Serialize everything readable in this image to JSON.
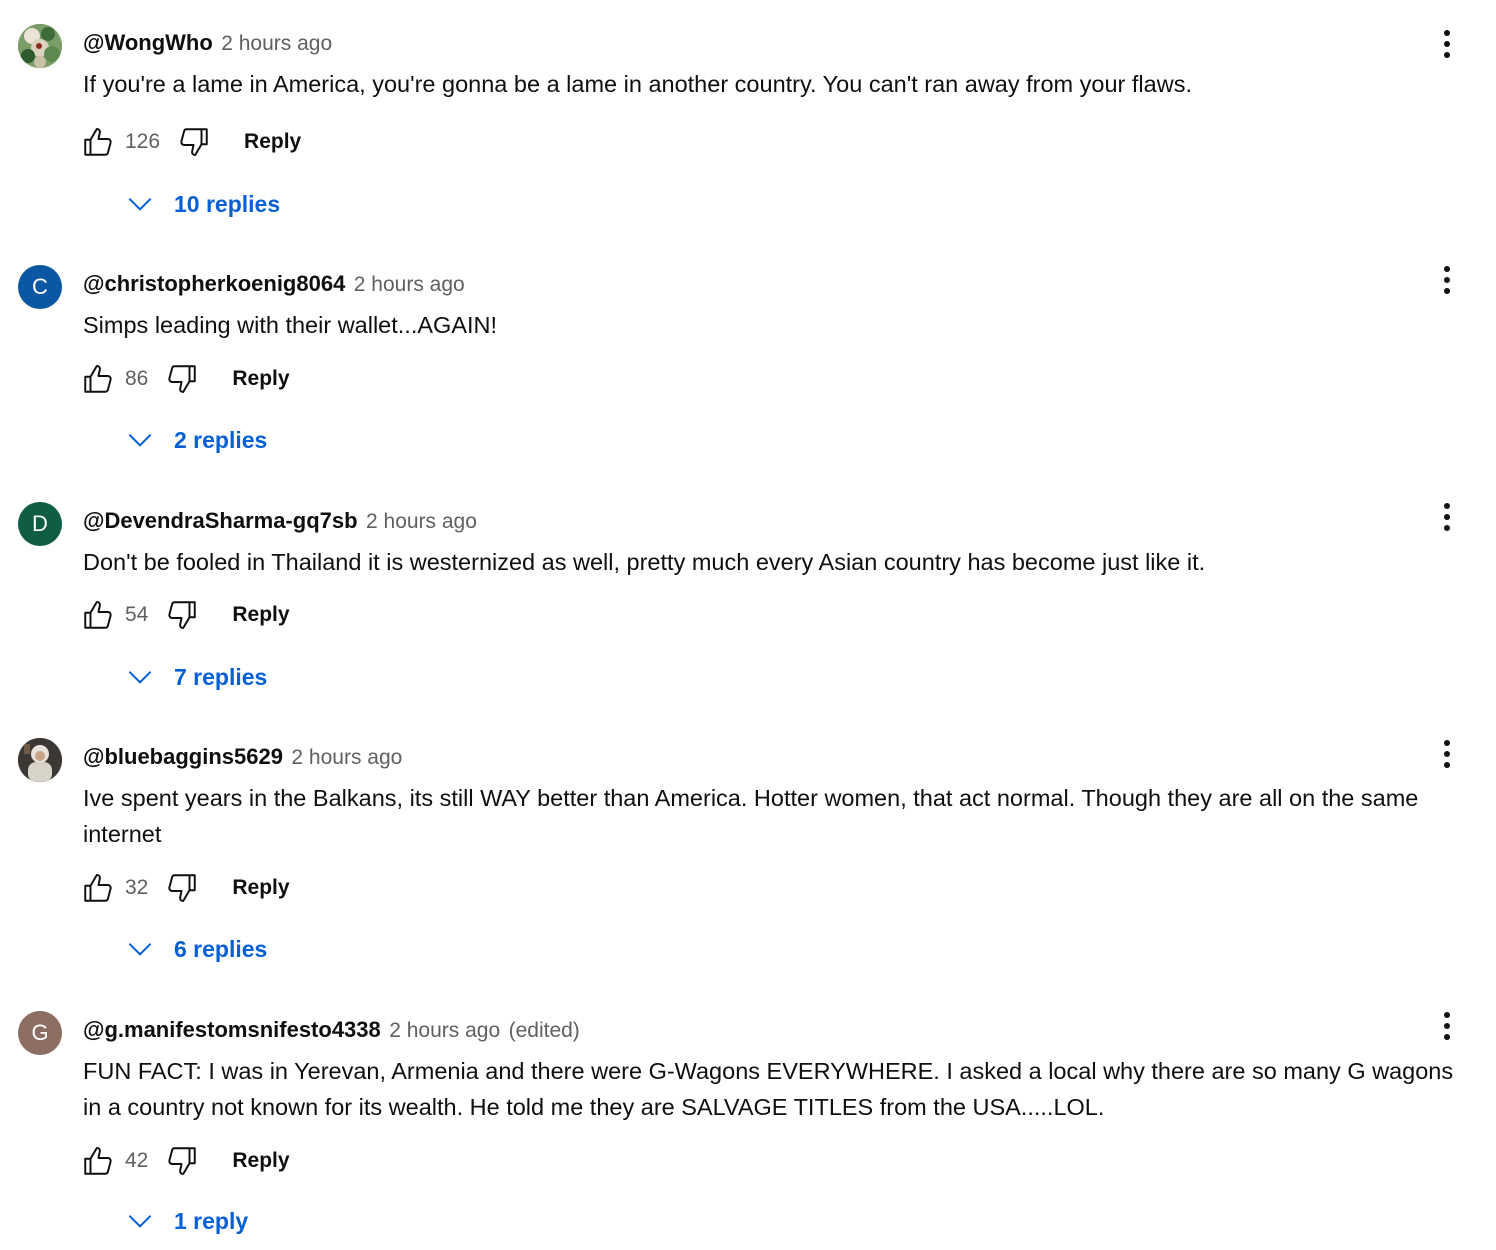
{
  "comments": [
    {
      "author": "@WongWho",
      "time": "2 hours ago",
      "edited": "",
      "text": "If you're a lame in America, you're gonna be a lame in another country. You can't ran away from your flaws.",
      "likes": "126",
      "reply_label": "Reply",
      "replies_label": "10 replies",
      "avatar": {
        "type": "image",
        "icon": "profile-photo-icon"
      }
    },
    {
      "author": "@christopherkoenig8064",
      "time": "2 hours ago",
      "edited": "",
      "text": "Simps leading with their wallet...AGAIN!",
      "likes": "86",
      "reply_label": "Reply",
      "replies_label": "2 replies",
      "avatar": {
        "type": "letter",
        "letter": "C",
        "color": "#0b57a4"
      }
    },
    {
      "author": "@DevendraSharma-gq7sb",
      "time": "2 hours ago",
      "edited": "",
      "text": "Don't be fooled in Thailand it is westernized as well, pretty much every Asian country has become just like it.",
      "likes": "54",
      "reply_label": "Reply",
      "replies_label": "7 replies",
      "avatar": {
        "type": "letter",
        "letter": "D",
        "color": "#0e5d44"
      }
    },
    {
      "author": "@bluebaggins5629",
      "time": "2 hours ago",
      "edited": "",
      "text": "Ive spent years in the Balkans, its still WAY better than America. Hotter women, that act normal. Though they are all on the same internet",
      "likes": "32",
      "reply_label": "Reply",
      "replies_label": "6 replies",
      "avatar": {
        "type": "image",
        "icon": "profile-photo-icon"
      }
    },
    {
      "author": "@g.manifestomsnifesto4338",
      "time": "2 hours ago",
      "edited": "(edited)",
      "text": "FUN FACT: I was in Yerevan, Armenia and there were G-Wagons EVERYWHERE. I asked a local why there are so many G wagons in a country not known for its wealth. He told me they are SALVAGE TITLES from the USA.....LOL.",
      "likes": "42",
      "reply_label": "Reply",
      "replies_label": "1 reply",
      "avatar": {
        "type": "letter",
        "letter": "G",
        "color": "#8d6e63"
      }
    }
  ],
  "icons": {
    "like": "thumbs-up-icon",
    "dislike": "thumbs-down-icon",
    "menu": "more-vert-icon",
    "expand": "chevron-down-icon"
  },
  "colors": {
    "link_blue": "#065fd4",
    "secondary_text": "#606060",
    "primary_text": "#0f0f0f"
  }
}
